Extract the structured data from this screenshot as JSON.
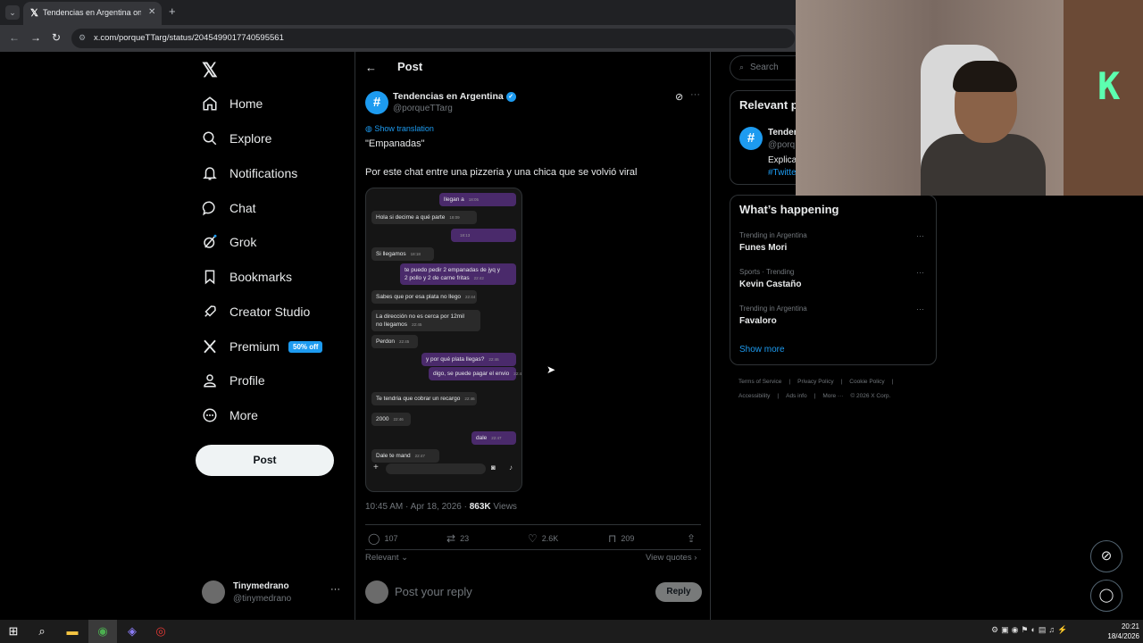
{
  "browser": {
    "tab_title": "Tendencias en Argentina on X: \"",
    "url": "x.com/porqueTTarg/status/2045499017740595561"
  },
  "sidebar": {
    "items": [
      {
        "label": "Home",
        "icon": "home-icon"
      },
      {
        "label": "Explore",
        "icon": "search-icon"
      },
      {
        "label": "Notifications",
        "icon": "bell-icon"
      },
      {
        "label": "Chat",
        "icon": "chat-bubble-icon"
      },
      {
        "label": "Grok",
        "icon": "grok-icon"
      },
      {
        "label": "Bookmarks",
        "icon": "bookmark-icon"
      },
      {
        "label": "Creator Studio",
        "icon": "rocket-icon"
      },
      {
        "label": "Premium",
        "icon": "x-logo-icon",
        "badge": "50% off"
      },
      {
        "label": "Profile",
        "icon": "person-icon"
      },
      {
        "label": "More",
        "icon": "more-circle-icon"
      }
    ],
    "post_button": "Post",
    "user": {
      "name": "Tinymedrano",
      "handle": "@tinymedrano"
    }
  },
  "main": {
    "header_title": "Post",
    "author": {
      "name": "Tendencias en Argentina",
      "handle": "@porqueTTarg"
    },
    "show_translation": "Show translation",
    "text_line1": "\"Empanadas\"",
    "text_line2": "Por este chat entre una pizzeria y una chica que se volvió viral",
    "chat_messages": [
      {
        "text": "llegan a",
        "time": "18:05",
        "dir": "out"
      },
      {
        "text": "Hola si decime a qué parte",
        "time": "18:09",
        "dir": "in"
      },
      {
        "text": "",
        "time": "18:13",
        "dir": "out"
      },
      {
        "text": "Si llegamos",
        "time": "18:18",
        "dir": "in"
      },
      {
        "text": "te puedo pedir 2 empanadas de jyq y",
        "text2": "2 pollo y 2 de carne fritas",
        "time": "22:42",
        "dir": "out"
      },
      {
        "text": "Sabes que por esa plata no llego",
        "time": "22:44",
        "dir": "in"
      },
      {
        "text": "La dirección no es cerca  por 12mil",
        "text2": "no llegamos",
        "time": "22:45",
        "dir": "in"
      },
      {
        "text": "Perdon",
        "time": "22:45",
        "dir": "in"
      },
      {
        "text": "y por qué plata llegas?",
        "time": "22:46",
        "dir": "out"
      },
      {
        "text": "digo, se puede pagar el envio",
        "time": "22:46",
        "dir": "out"
      },
      {
        "text": "Te tendria que cobrar un recargo",
        "time": "22:46",
        "dir": "in"
      },
      {
        "text": "2000",
        "time": "22:46",
        "dir": "in"
      },
      {
        "text": "dale",
        "time": "22:47",
        "dir": "out"
      },
      {
        "text": "Dale te mand",
        "time": "22:47",
        "dir": "in"
      }
    ],
    "timestamp": "10:45 AM · Apr 18, 2026 · ",
    "views_count": "863K",
    "views_label": " Views",
    "actions": {
      "replies": "107",
      "reposts": "23",
      "likes": "2.6K",
      "bookmarks": "209"
    },
    "relevant": "Relevant",
    "view_quotes": "View quotes",
    "reply_placeholder": "Post your reply",
    "reply_button": "Reply"
  },
  "right": {
    "search_placeholder": "Search",
    "relevant_title": "Relevant p",
    "relevant_name": "Tender",
    "relevant_handle": "@porq",
    "relevant_bio": "Explica",
    "relevant_tag": "#Twitte",
    "happening_title": "What’s happening",
    "trends": [
      {
        "context": "Trending in Argentina",
        "name": "Funes Mori"
      },
      {
        "context": "Sports · Trending",
        "name": "Kevin Castaño"
      },
      {
        "context": "Trending in Argentina",
        "name": "Favaloro"
      }
    ],
    "show_more": "Show more",
    "footer_line1": [
      "Terms of Service",
      "|",
      "Privacy Policy",
      "|",
      "Cookie Policy",
      "|"
    ],
    "footer_line2": [
      "Accessibility",
      "|",
      "Ads info",
      "|",
      "More ···",
      "© 2026 X Corp."
    ]
  },
  "taskbar": {
    "time": "20:21",
    "date": "18/4/2026"
  }
}
